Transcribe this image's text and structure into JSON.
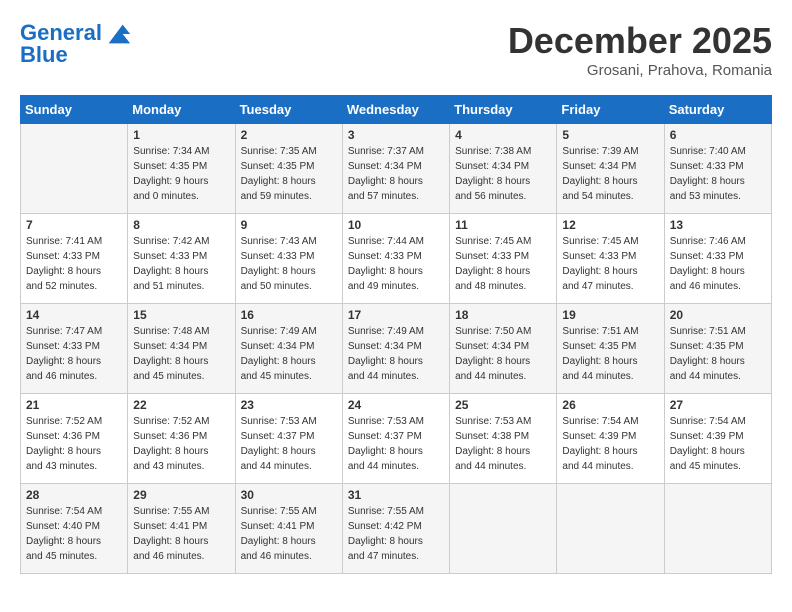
{
  "header": {
    "logo_line1": "General",
    "logo_line2": "Blue",
    "month": "December 2025",
    "location": "Grosani, Prahova, Romania"
  },
  "days_of_week": [
    "Sunday",
    "Monday",
    "Tuesday",
    "Wednesday",
    "Thursday",
    "Friday",
    "Saturday"
  ],
  "weeks": [
    [
      {
        "day": "",
        "info": ""
      },
      {
        "day": "1",
        "info": "Sunrise: 7:34 AM\nSunset: 4:35 PM\nDaylight: 9 hours\nand 0 minutes."
      },
      {
        "day": "2",
        "info": "Sunrise: 7:35 AM\nSunset: 4:35 PM\nDaylight: 8 hours\nand 59 minutes."
      },
      {
        "day": "3",
        "info": "Sunrise: 7:37 AM\nSunset: 4:34 PM\nDaylight: 8 hours\nand 57 minutes."
      },
      {
        "day": "4",
        "info": "Sunrise: 7:38 AM\nSunset: 4:34 PM\nDaylight: 8 hours\nand 56 minutes."
      },
      {
        "day": "5",
        "info": "Sunrise: 7:39 AM\nSunset: 4:34 PM\nDaylight: 8 hours\nand 54 minutes."
      },
      {
        "day": "6",
        "info": "Sunrise: 7:40 AM\nSunset: 4:33 PM\nDaylight: 8 hours\nand 53 minutes."
      }
    ],
    [
      {
        "day": "7",
        "info": "Sunrise: 7:41 AM\nSunset: 4:33 PM\nDaylight: 8 hours\nand 52 minutes."
      },
      {
        "day": "8",
        "info": "Sunrise: 7:42 AM\nSunset: 4:33 PM\nDaylight: 8 hours\nand 51 minutes."
      },
      {
        "day": "9",
        "info": "Sunrise: 7:43 AM\nSunset: 4:33 PM\nDaylight: 8 hours\nand 50 minutes."
      },
      {
        "day": "10",
        "info": "Sunrise: 7:44 AM\nSunset: 4:33 PM\nDaylight: 8 hours\nand 49 minutes."
      },
      {
        "day": "11",
        "info": "Sunrise: 7:45 AM\nSunset: 4:33 PM\nDaylight: 8 hours\nand 48 minutes."
      },
      {
        "day": "12",
        "info": "Sunrise: 7:45 AM\nSunset: 4:33 PM\nDaylight: 8 hours\nand 47 minutes."
      },
      {
        "day": "13",
        "info": "Sunrise: 7:46 AM\nSunset: 4:33 PM\nDaylight: 8 hours\nand 46 minutes."
      }
    ],
    [
      {
        "day": "14",
        "info": "Sunrise: 7:47 AM\nSunset: 4:33 PM\nDaylight: 8 hours\nand 46 minutes."
      },
      {
        "day": "15",
        "info": "Sunrise: 7:48 AM\nSunset: 4:34 PM\nDaylight: 8 hours\nand 45 minutes."
      },
      {
        "day": "16",
        "info": "Sunrise: 7:49 AM\nSunset: 4:34 PM\nDaylight: 8 hours\nand 45 minutes."
      },
      {
        "day": "17",
        "info": "Sunrise: 7:49 AM\nSunset: 4:34 PM\nDaylight: 8 hours\nand 44 minutes."
      },
      {
        "day": "18",
        "info": "Sunrise: 7:50 AM\nSunset: 4:34 PM\nDaylight: 8 hours\nand 44 minutes."
      },
      {
        "day": "19",
        "info": "Sunrise: 7:51 AM\nSunset: 4:35 PM\nDaylight: 8 hours\nand 44 minutes."
      },
      {
        "day": "20",
        "info": "Sunrise: 7:51 AM\nSunset: 4:35 PM\nDaylight: 8 hours\nand 44 minutes."
      }
    ],
    [
      {
        "day": "21",
        "info": "Sunrise: 7:52 AM\nSunset: 4:36 PM\nDaylight: 8 hours\nand 43 minutes."
      },
      {
        "day": "22",
        "info": "Sunrise: 7:52 AM\nSunset: 4:36 PM\nDaylight: 8 hours\nand 43 minutes."
      },
      {
        "day": "23",
        "info": "Sunrise: 7:53 AM\nSunset: 4:37 PM\nDaylight: 8 hours\nand 44 minutes."
      },
      {
        "day": "24",
        "info": "Sunrise: 7:53 AM\nSunset: 4:37 PM\nDaylight: 8 hours\nand 44 minutes."
      },
      {
        "day": "25",
        "info": "Sunrise: 7:53 AM\nSunset: 4:38 PM\nDaylight: 8 hours\nand 44 minutes."
      },
      {
        "day": "26",
        "info": "Sunrise: 7:54 AM\nSunset: 4:39 PM\nDaylight: 8 hours\nand 44 minutes."
      },
      {
        "day": "27",
        "info": "Sunrise: 7:54 AM\nSunset: 4:39 PM\nDaylight: 8 hours\nand 45 minutes."
      }
    ],
    [
      {
        "day": "28",
        "info": "Sunrise: 7:54 AM\nSunset: 4:40 PM\nDaylight: 8 hours\nand 45 minutes."
      },
      {
        "day": "29",
        "info": "Sunrise: 7:55 AM\nSunset: 4:41 PM\nDaylight: 8 hours\nand 46 minutes."
      },
      {
        "day": "30",
        "info": "Sunrise: 7:55 AM\nSunset: 4:41 PM\nDaylight: 8 hours\nand 46 minutes."
      },
      {
        "day": "31",
        "info": "Sunrise: 7:55 AM\nSunset: 4:42 PM\nDaylight: 8 hours\nand 47 minutes."
      },
      {
        "day": "",
        "info": ""
      },
      {
        "day": "",
        "info": ""
      },
      {
        "day": "",
        "info": ""
      }
    ]
  ]
}
